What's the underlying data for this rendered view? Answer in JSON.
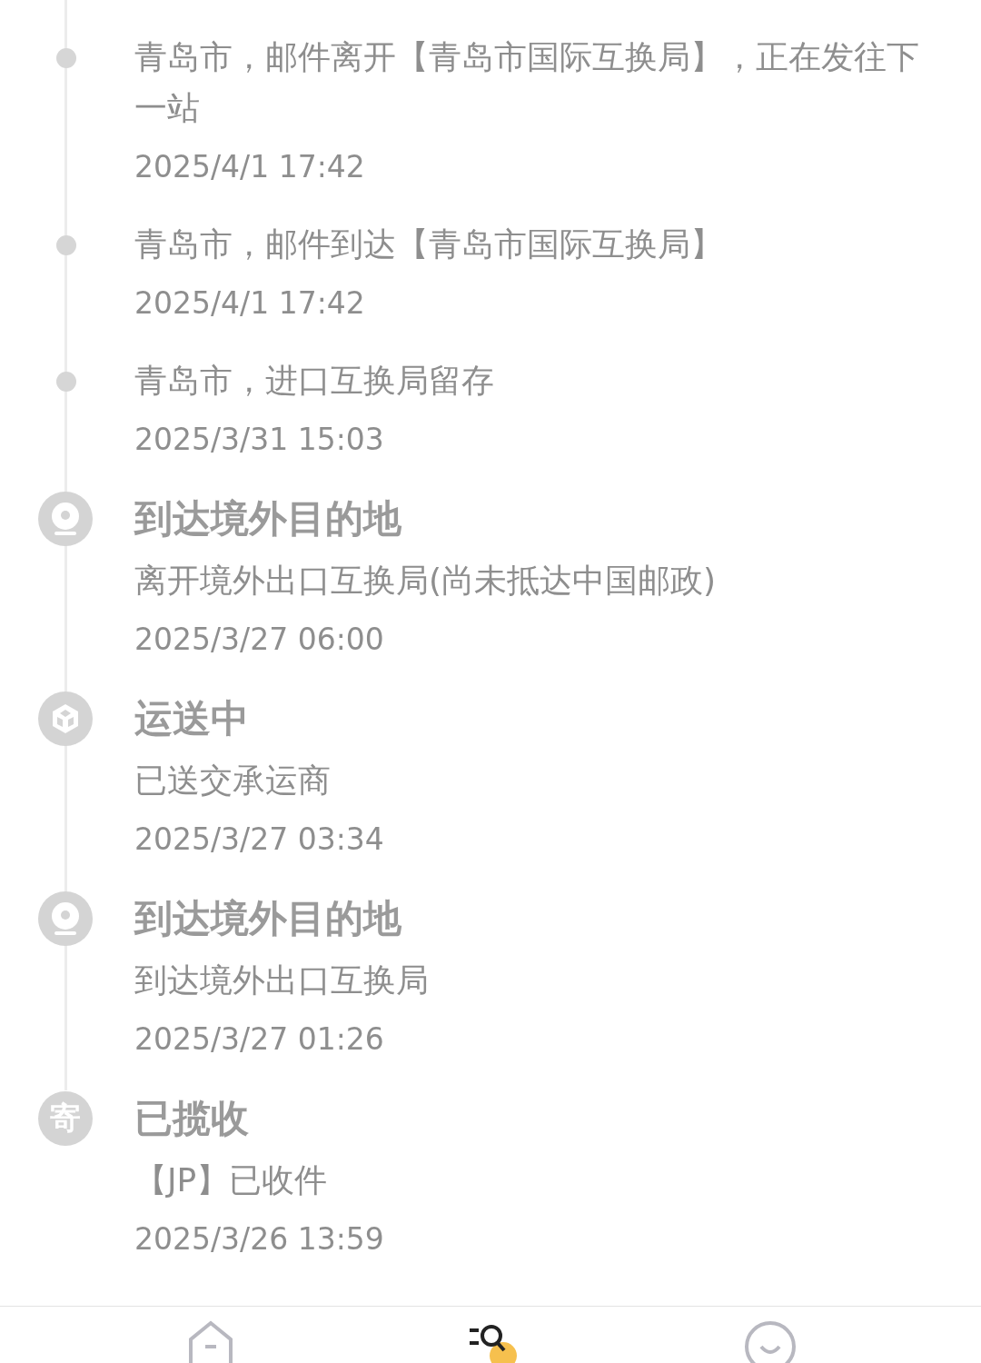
{
  "events": [
    {
      "kind": "dot",
      "text": "青岛市，邮件离开【青岛市国际互换局】，正在发往下一站",
      "time": "2025/4/1 17:42"
    },
    {
      "kind": "dot",
      "text": "青岛市，邮件到达【青岛市国际互换局】",
      "time": "2025/4/1 17:42"
    },
    {
      "kind": "dot",
      "text": "青岛市，进口互换局留存",
      "time": "2025/3/31 15:03"
    },
    {
      "kind": "pin",
      "title": "到达境外目的地",
      "text": "离开境外出口互换局(尚未抵达中国邮政)",
      "time": "2025/3/27 06:00"
    },
    {
      "kind": "box",
      "title": "运送中",
      "text": "已送交承运商",
      "time": "2025/3/27 03:34"
    },
    {
      "kind": "pin",
      "title": "到达境外目的地",
      "text": "到达境外出口互换局",
      "time": "2025/3/27 01:26"
    },
    {
      "kind": "glyph",
      "icon_text": "寄",
      "title": "已揽收",
      "text": "【JP】已收件",
      "time": "2025/3/26 13:59"
    }
  ],
  "nav": [
    {
      "kind": "home",
      "selected": false
    },
    {
      "kind": "search",
      "selected": true
    },
    {
      "kind": "profile",
      "selected": false
    }
  ]
}
